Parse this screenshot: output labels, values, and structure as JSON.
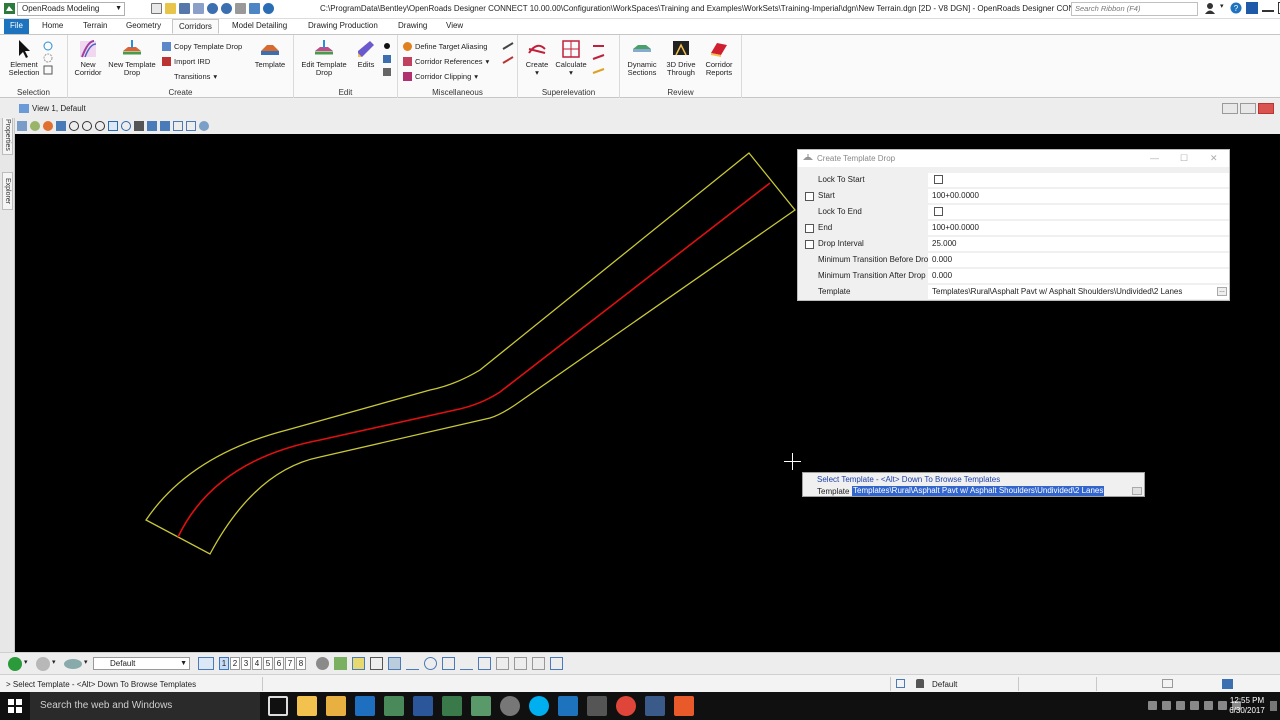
{
  "titlebar": {
    "workspace": "OpenRoads Modeling",
    "title": "C:\\ProgramData\\Bentley\\OpenRoads Designer CONNECT 10.00.00\\Configuration\\WorkSpaces\\Training and Examples\\WorkSets\\Training-Imperial\\dgn\\New Terrain.dgn [2D - V8 DGN] - OpenRoads Designer CON...",
    "search_placeholder": "Search Ribbon (F4)"
  },
  "tabs": [
    "File",
    "Home",
    "Terrain",
    "Geometry",
    "Corridors",
    "Model Detailing",
    "Drawing Production",
    "Drawing",
    "View"
  ],
  "ribbon": {
    "selection": {
      "label": "Selection",
      "element_selection": "Element Selection"
    },
    "create": {
      "label": "Create",
      "new_corridor": "New Corridor",
      "new_template_drop": "New Template Drop",
      "copy_template_drop": "Copy Template Drop",
      "import_ird": "Import IRD",
      "transitions": "Transitions",
      "template": "Template"
    },
    "edit": {
      "label": "Edit",
      "edit_template_drop": "Edit Template Drop",
      "edits": "Edits"
    },
    "misc": {
      "label": "Miscellaneous",
      "define_target_aliasing": "Define Target Aliasing",
      "corridor_references": "Corridor References",
      "corridor_clipping": "Corridor Clipping"
    },
    "superelevation": {
      "label": "Superelevation",
      "create": "Create",
      "calculate": "Calculate"
    },
    "review": {
      "label": "Review",
      "dynamic_sections": "Dynamic Sections",
      "drive_through": "3D Drive Through",
      "corridor_reports": "Corridor Reports"
    }
  },
  "view": {
    "title": "View 1, Default"
  },
  "siderail": {
    "properties": "Properties",
    "explorer": "Explorer"
  },
  "dialog": {
    "title": "Create Template Drop",
    "rows": [
      {
        "label": "Lock To Start",
        "value": ""
      },
      {
        "label": "Start",
        "value": "100+00.0000"
      },
      {
        "label": "Lock To End",
        "value": ""
      },
      {
        "label": "End",
        "value": "100+00.0000"
      },
      {
        "label": "Drop Interval",
        "value": "25.000"
      },
      {
        "label": "Minimum Transition Before Drop",
        "value": "0.000"
      },
      {
        "label": "Minimum Transition After Drop",
        "value": "0.000"
      },
      {
        "label": "Template",
        "value": "Templates\\Rural\\Asphalt Pavt w/ Asphalt Shoulders\\Undivided\\2 Lanes"
      }
    ]
  },
  "prompt": {
    "instruction": "Select Template - <Alt> Down To Browse Templates",
    "field_label": "Template",
    "field_value": "Templates\\Rural\\Asphalt Pavt w/ Asphalt Shoulders\\Undivided\\2 Lanes"
  },
  "bottombar": {
    "level": "Default",
    "view_numbers": [
      "1",
      "2",
      "3",
      "4",
      "5",
      "6",
      "7",
      "8"
    ]
  },
  "status": {
    "message": "> Select Template - <Alt> Down To Browse Templates",
    "level": "Default"
  },
  "taskbar": {
    "search": "Search the web and Windows",
    "time": "12:55 PM",
    "date": "6/30/2017"
  },
  "colors": {
    "accent": "#1e73be",
    "canvas": "#000000",
    "corridor_edge": "#c8c837",
    "centerline": "#e01010"
  }
}
